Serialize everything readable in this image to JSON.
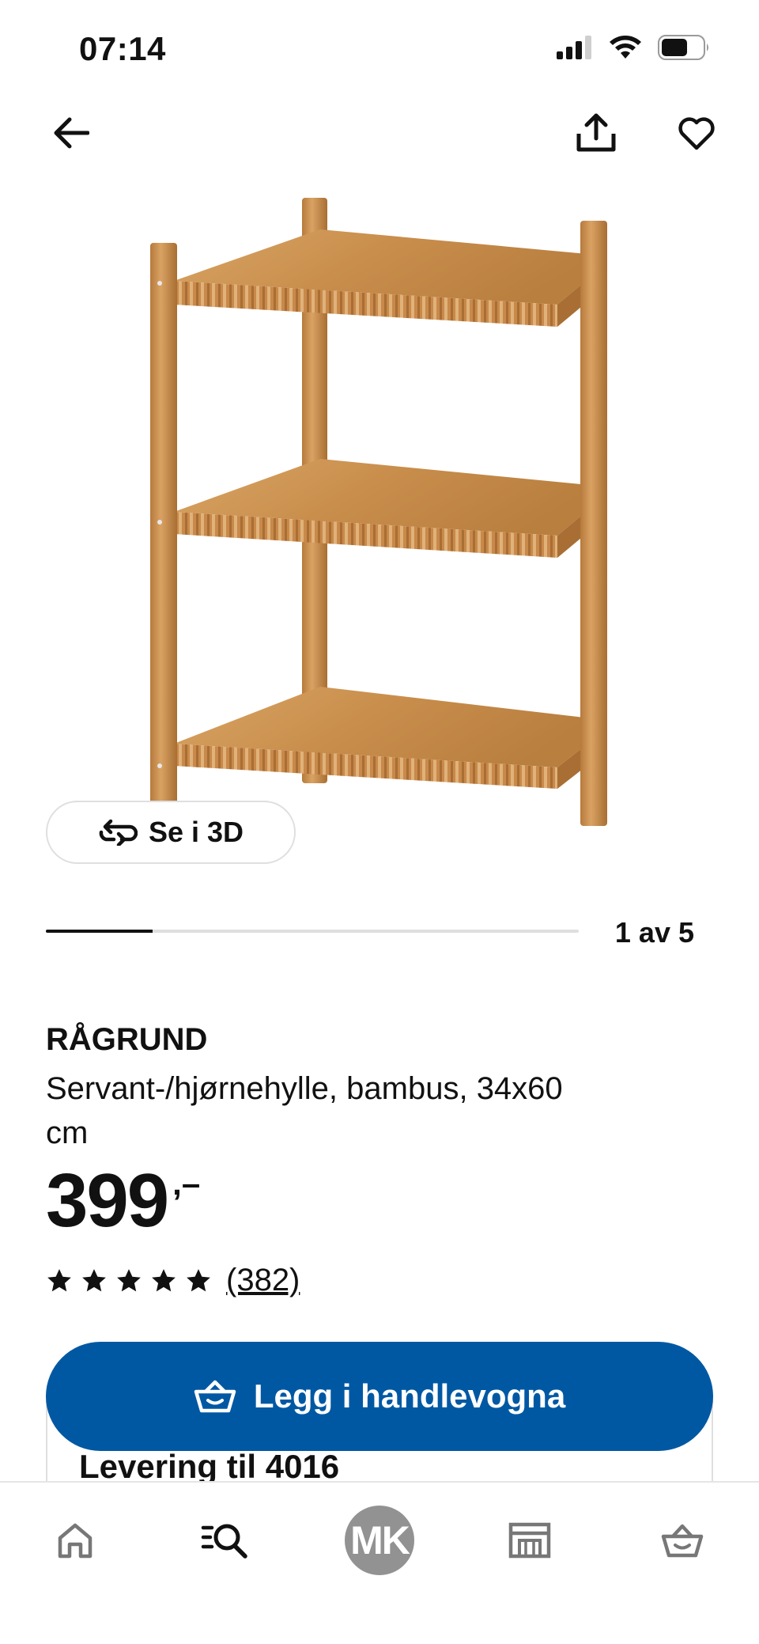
{
  "status_bar": {
    "time": "07:14",
    "icons": [
      "signal-icon",
      "wifi-icon",
      "battery-icon"
    ]
  },
  "top_nav": {
    "icons": [
      "back-arrow-icon",
      "share-icon",
      "heart-icon"
    ]
  },
  "gallery": {
    "see_3d_label": "Se i 3D",
    "position_text": "1 av 5",
    "progress_fraction": 0.2
  },
  "product": {
    "name": "RÅGRUND",
    "description": "Servant-/hjørnehylle, bambus, 34x60 cm",
    "price": "399",
    "price_suffix": ",–",
    "rating_stars": 5,
    "review_count": "(382)"
  },
  "cart": {
    "button_label": "Legg i handlevogna",
    "delivery_text": "Levering til 4016"
  },
  "bottom_nav": {
    "items": [
      "home-icon",
      "search-list-icon",
      "profile-avatar",
      "store-icon",
      "basket-icon"
    ],
    "avatar_initials": "MK"
  },
  "colors": {
    "primary_blue": "#0058a3",
    "text": "#111111",
    "avatar_gray": "#929292",
    "bamboo": "#c98e4c"
  }
}
